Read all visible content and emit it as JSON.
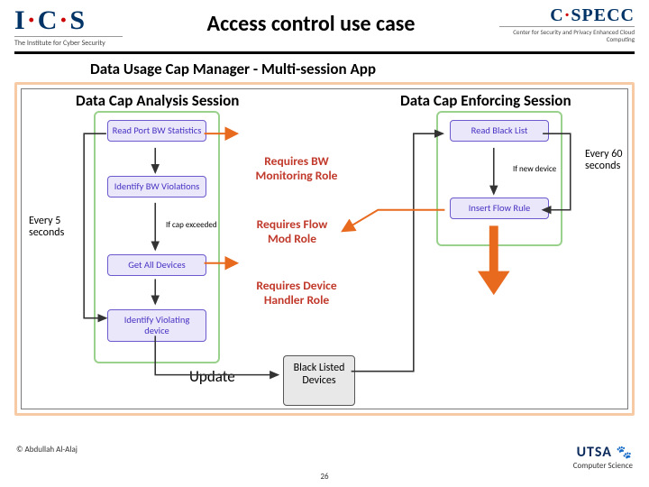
{
  "header": {
    "title": "Access control use case",
    "logo_left": {
      "main": "I·C·S",
      "sub": "The Institute for Cyber Security"
    },
    "logo_right": {
      "main": "C·SPECC",
      "sub": "Center for Security and Privacy Enhanced Cloud Computing"
    }
  },
  "subtitle": "Data Usage Cap Manager - Multi-session App",
  "sessions": {
    "analysis_title": "Data Cap Analysis Session",
    "enforce_title": "Data Cap Enforcing Session"
  },
  "steps": {
    "read_port": "Read Port BW Statistics",
    "identify_bw": "Identify BW Violations",
    "get_devices": "Get All Devices",
    "identify_vd": "Identify Violating device",
    "read_bl": "Read Black List",
    "insert": "Insert Flow Rule"
  },
  "annotations": {
    "every5": "Every 5 seconds",
    "every60": "Every 60 seconds",
    "if_cap": "If cap exceeded",
    "if_new": "If new device",
    "update": "Update",
    "req_bw": "Requires BW Monitoring Role",
    "req_flow": "Requires Flow Mod Role",
    "req_dev": "Requires Device Handler Role"
  },
  "blacklist_box": "Black Listed Devices",
  "footer": {
    "copyright": "© Abdullah Al-Alaj",
    "page": "26",
    "utsa": "UTSA",
    "utsa_sub": "Computer Science"
  }
}
